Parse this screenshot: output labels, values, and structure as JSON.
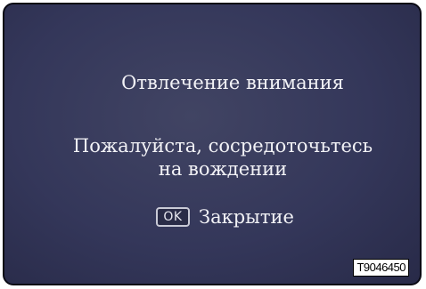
{
  "dialog": {
    "title": "Отвлечение внимания",
    "message_line1": "Пожалуйста, сосредоточьтесь",
    "message_line2": "на вождении",
    "ok_key_label": "OK",
    "close_label": "Закрытие"
  },
  "image_code": "T9046450",
  "colors": {
    "background": "#34375a",
    "text": "#f2f2f6",
    "ok_key_border": "#c9cad6"
  }
}
